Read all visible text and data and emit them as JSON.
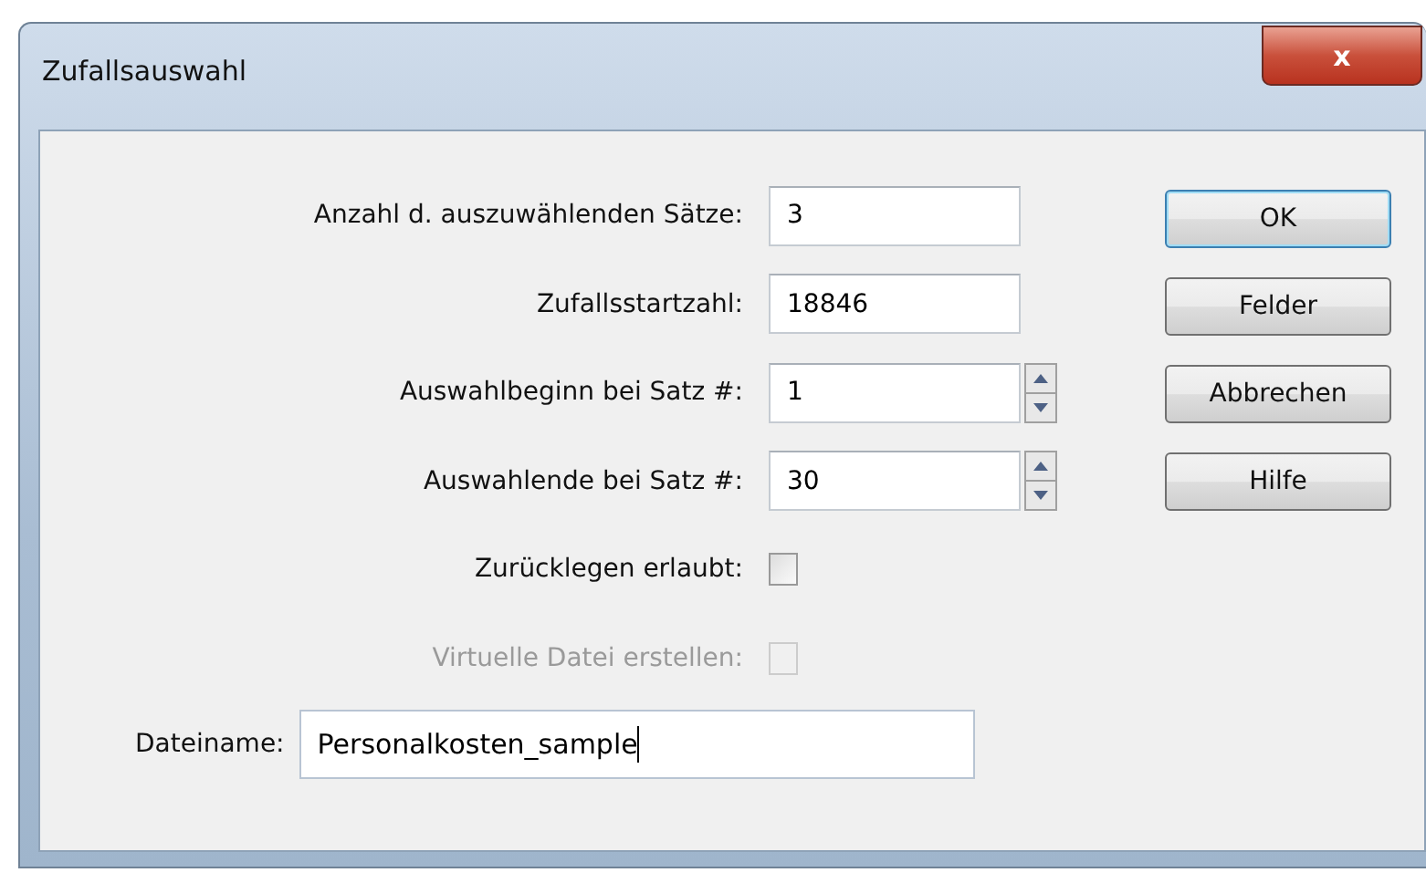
{
  "window": {
    "title": "Zufallsauswahl",
    "close_label": "x"
  },
  "fields": [
    {
      "kind": "text",
      "label": "Anzahl d. auszuwählenden Sätze:",
      "value": "3"
    },
    {
      "kind": "text",
      "label": "Zufallsstartzahl:",
      "value": "18846"
    },
    {
      "kind": "spin",
      "label": "Auswahlbeginn bei Satz #:",
      "value": "1"
    },
    {
      "kind": "spin",
      "label": "Auswahlende bei Satz #:",
      "value": "30"
    },
    {
      "kind": "check",
      "label": "Zurücklegen erlaubt:",
      "checked": false,
      "disabled": false
    },
    {
      "kind": "check",
      "label": "Virtuelle Datei erstellen:",
      "checked": false,
      "disabled": true
    }
  ],
  "filename": {
    "label": "Dateiname:",
    "value": "Personalkosten_sample",
    "focused": true
  },
  "buttons": [
    {
      "label": "OK",
      "default": true
    },
    {
      "label": "Felder",
      "default": false
    },
    {
      "label": "Abbrechen",
      "default": false
    },
    {
      "label": "Hilfe",
      "default": false
    }
  ]
}
